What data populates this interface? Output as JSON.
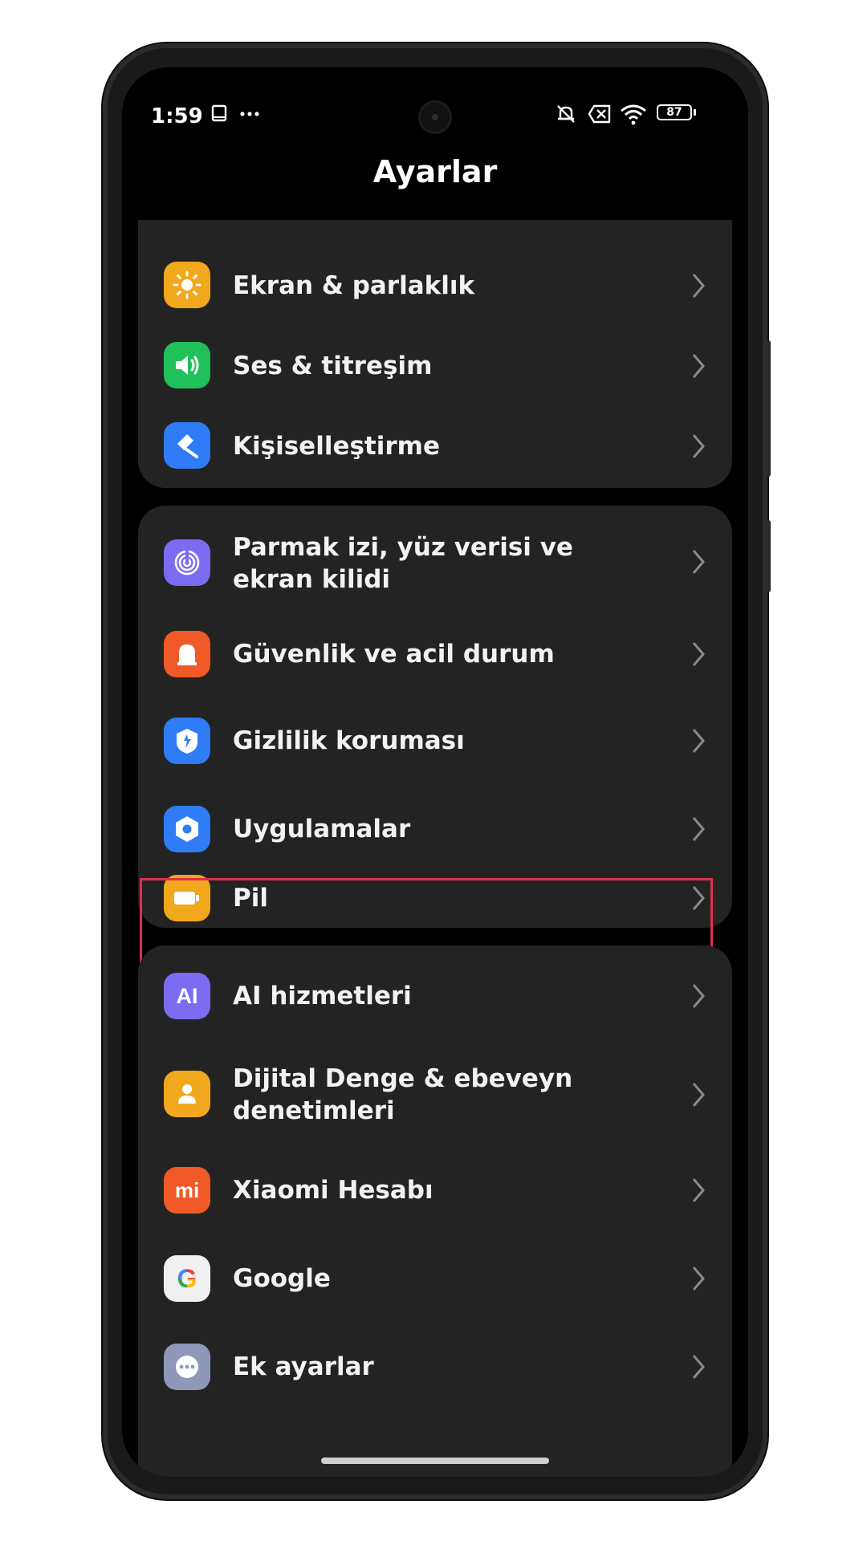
{
  "status": {
    "time": "1:59",
    "battery": "87"
  },
  "header": {
    "title": "Ayarlar"
  },
  "sections": [
    {
      "items": [
        {
          "label": "Ekran & parlaklık",
          "icon": "sun-icon",
          "color": "#F2A81D"
        },
        {
          "label": "Ses & titreşim",
          "icon": "speaker-icon",
          "color": "#20C15A"
        },
        {
          "label": "Kişiselleştirme",
          "icon": "brush-icon",
          "color": "#2F7CF6"
        }
      ]
    },
    {
      "items": [
        {
          "label": "Parmak izi, yüz verisi ve ekran kilidi",
          "icon": "fingerprint-icon",
          "color": "#7C6CF2"
        },
        {
          "label": "Güvenlik ve acil durum",
          "icon": "emergency-light-icon",
          "color": "#F05A28"
        },
        {
          "label": "Gizlilik koruması",
          "icon": "privacy-shield-icon",
          "color": "#2F7CF6"
        },
        {
          "label": "Uygulamalar",
          "icon": "apps-hexagon-icon",
          "color": "#2F7CF6"
        },
        {
          "label": "Pil",
          "icon": "battery-icon",
          "color": "#F2A81D"
        }
      ]
    },
    {
      "items": [
        {
          "label": "AI hizmetleri",
          "icon": "ai-icon",
          "color": "#7C6CF2",
          "icon_text": "AI"
        },
        {
          "label": "Dijital Denge & ebeveyn denetimleri",
          "icon": "person-icon",
          "color": "#F2A81D"
        },
        {
          "label": "Xiaomi Hesabı",
          "icon": "mi-logo-icon",
          "color": "#F05A28",
          "icon_text": "mi"
        },
        {
          "label": "Google",
          "icon": "google-icon",
          "color": "#FFFFFF",
          "icon_text": "G"
        },
        {
          "label": "Ek ayarlar",
          "icon": "more-icon",
          "color": "#8E98B8"
        }
      ]
    }
  ]
}
